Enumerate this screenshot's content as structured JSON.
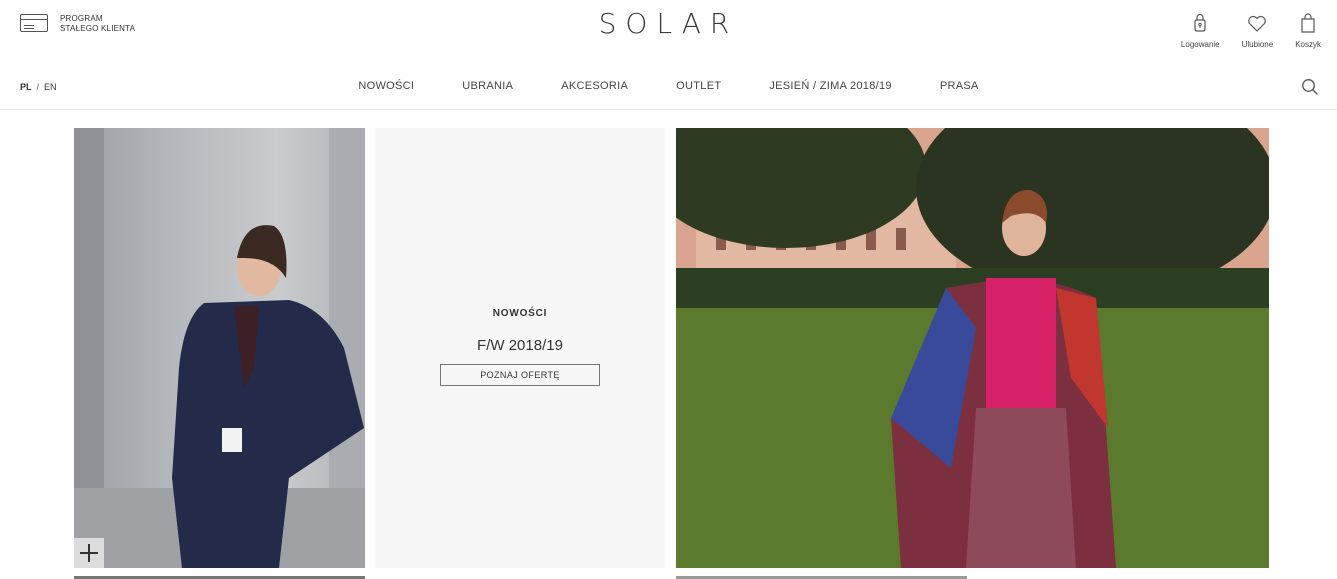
{
  "header": {
    "loyalty": {
      "line1": "PROGRAM",
      "line2": "STAŁEGO KLIENTA",
      "icon": "loyalty-card-icon"
    },
    "logo": "SOLAR",
    "user_nav": [
      {
        "label": "Logowanie",
        "icon": "user-lock-icon"
      },
      {
        "label": "Ulubione",
        "icon": "heart-icon"
      },
      {
        "label": "Koszyk",
        "icon": "shopping-bag-icon"
      }
    ]
  },
  "nav": {
    "lang": {
      "active": "PL",
      "separator": "/",
      "other": "EN"
    },
    "menu": [
      "NOWOŚCI",
      "UBRANIA",
      "AKCESORIA",
      "OUTLET",
      "JESIEŃ / ZIMA 2018/19",
      "PRASA"
    ],
    "search_icon": "search-icon"
  },
  "tiles": {
    "center": {
      "title": "NOWOŚCI",
      "subtitle": "F/W 2018/19",
      "button": "POZNAJ OFERTĘ"
    },
    "left": {
      "overlay_icon": "plus-icon"
    }
  },
  "colors": {
    "text": "#333333",
    "tile_bg": "#f7f7f7",
    "border": "#eaeaea"
  }
}
